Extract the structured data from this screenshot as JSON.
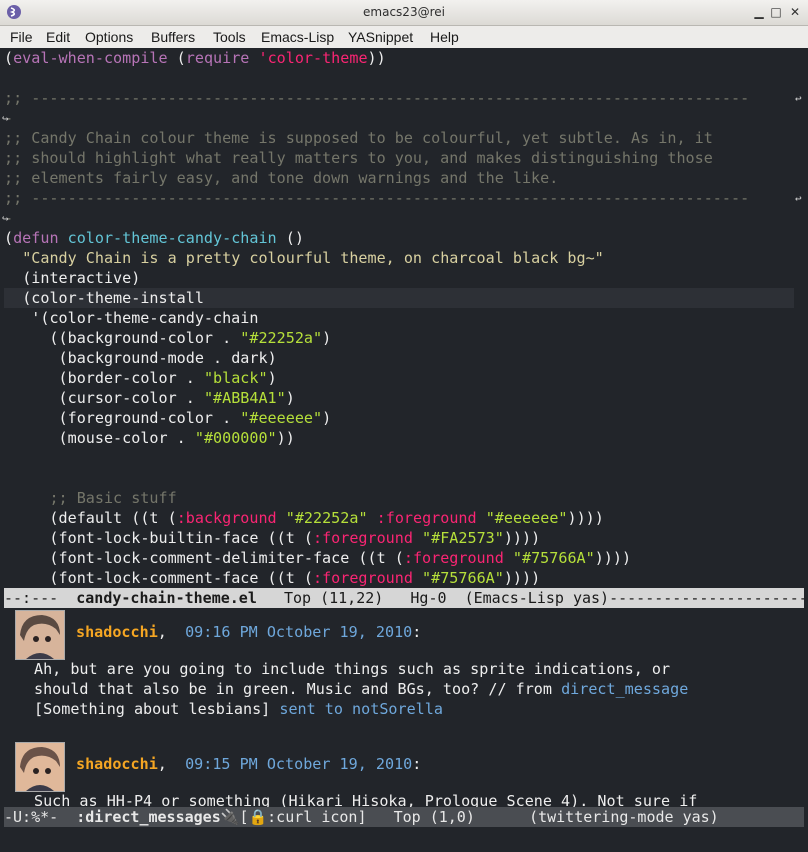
{
  "window": {
    "title": "emacs23@rei"
  },
  "menu": [
    "File",
    "Edit",
    "Options",
    "Buffers",
    "Tools",
    "Emacs-Lisp",
    "YASnippet",
    "Help"
  ],
  "editor": {
    "eval": "(eval-when-compile (require 'color-theme))",
    "comments": [
      ";; Candy Chain colour theme is supposed to be colourful, yet subtle. As in, it",
      ";; should highlight what really matters to you, and makes distinguishing those",
      ";; elements fairly easy, and tone down warnings and the like."
    ],
    "defun": "defun",
    "defun_name": "color-theme-candy-chain",
    "docstring": "\"Candy Chain is a pretty colourful theme, on charcoal black bg~\"",
    "interactive": "(interactive)",
    "install": "(color-theme-install",
    "quoted": "'(color-theme-candy-chain",
    "params": [
      {
        "name": "background-color",
        "value": "\"#22252a\"",
        "string": true
      },
      {
        "name": "background-mode",
        "value": "dark",
        "string": false
      },
      {
        "name": "border-color",
        "value": "\"black\"",
        "string": true
      },
      {
        "name": "cursor-color",
        "value": "\"#ABB4A1\"",
        "string": true
      },
      {
        "name": "foreground-color",
        "value": "\"#eeeeee\"",
        "string": true
      },
      {
        "name": "mouse-color",
        "value": "\"#000000\"",
        "string": true
      }
    ],
    "basic_comment": ";; Basic stuff",
    "faces": [
      {
        "face": "default",
        "attrs": [
          [
            ":background",
            "\"#22252a\""
          ],
          [
            ":foreground",
            "\"#eeeeee\""
          ]
        ]
      },
      {
        "face": "font-lock-builtin-face",
        "attrs": [
          [
            ":foreground",
            "\"#FA2573\""
          ]
        ]
      },
      {
        "face": "font-lock-comment-delimiter-face",
        "attrs": [
          [
            ":foreground",
            "\"#75766A\""
          ]
        ]
      },
      {
        "face": "font-lock-comment-face",
        "attrs": [
          [
            ":foreground",
            "\"#75766A\""
          ]
        ]
      }
    ]
  },
  "modeline": {
    "status": "--:---",
    "buffer": "candy-chain-theme.el",
    "position": "Top (11,22)",
    "vc": "Hg-0",
    "modes": "(Emacs-Lisp yas)"
  },
  "tweets": [
    {
      "user": "shadocchi",
      "time": "09:16 PM October 19, 2010",
      "lines": [
        "Ah, but are you going to include things such as sprite indications, or",
        "should that also be in green. Music and BGs, too? // from "
      ],
      "source_link": "direct_message",
      "line3": "[Something about lesbians] ",
      "sent_to": "sent to notSorella"
    },
    {
      "user": "shadocchi",
      "time": "09:15 PM October 19, 2010",
      "lines": [
        "Such as HH-P4 or something (Hikari Hisoka, Prologue Scene 4). Not sure if"
      ]
    }
  ],
  "modeline2": {
    "status": "-U:%*-",
    "buffer": ":direct_messages",
    "extra": "[",
    "curl": ":curl icon]",
    "position": "Top (1,0)",
    "modes": "(twittering-mode yas)"
  },
  "colors": {
    "background": "#22252a",
    "foreground": "#eeeeee",
    "comment": "#75766A",
    "builtin": "#FA2573",
    "string": "#b6e03a",
    "function": "#63c5d6"
  }
}
